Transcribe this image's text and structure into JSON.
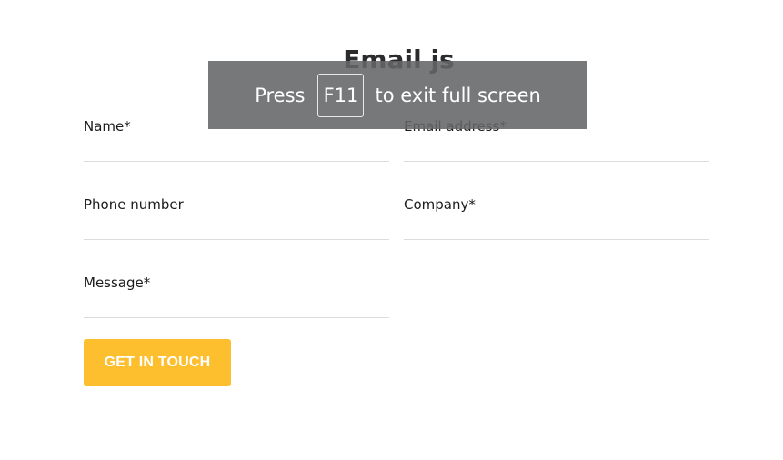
{
  "page": {
    "title": "Email js"
  },
  "form": {
    "fields": {
      "name": {
        "label": "Name*",
        "value": ""
      },
      "email": {
        "label": "Email address*",
        "value": ""
      },
      "phone": {
        "label": "Phone number",
        "value": ""
      },
      "company": {
        "label": "Company*",
        "value": ""
      },
      "message": {
        "label": "Message*",
        "value": ""
      }
    },
    "submit_label": "GET IN TOUCH"
  },
  "fullscreen_notice": {
    "press": "Press",
    "key": "F11",
    "suffix": "to exit full screen"
  },
  "colors": {
    "button_bg": "#fdbf2d",
    "button_text": "#ffffff",
    "overlay_bg": "#646568",
    "underline": "#dcdcdc"
  }
}
